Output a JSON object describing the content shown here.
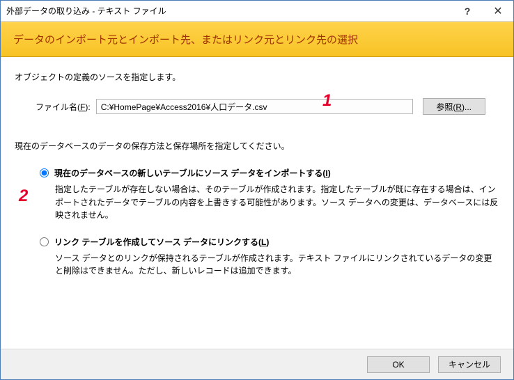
{
  "window": {
    "title": "外部データの取り込み - テキスト ファイル"
  },
  "header": {
    "banner": "データのインポート元とインポート先、またはリンク元とリンク先の選択"
  },
  "body": {
    "source_label": "オブジェクトの定義のソースを指定します。",
    "file_label_pre": "ファイル名(",
    "file_label_key": "F",
    "file_label_post": "):",
    "file_value": "C:¥HomePage¥Access2016¥人口データ.csv",
    "browse_pre": "参照(",
    "browse_key": "R",
    "browse_post": ")...",
    "instruction": "現在のデータベースのデータの保存方法と保存場所を指定してください。",
    "options": [
      {
        "label_pre": "現在のデータベースの新しいテーブルにソース データをインポートする(",
        "label_key": "I",
        "label_post": ")",
        "desc": "指定したテーブルが存在しない場合は、そのテーブルが作成されます。指定したテーブルが既に存在する場合は、インポートされたデータでテーブルの内容を上書きする可能性があります。ソース データへの変更は、データベースには反映されません。",
        "checked": true
      },
      {
        "label_pre": "リンク テーブルを作成してソース データにリンクする(",
        "label_key": "L",
        "label_post": ")",
        "desc": "ソース データとのリンクが保持されるテーブルが作成されます。テキスト ファイルにリンクされているデータの変更と削除はできません。ただし、新しいレコードは追加できます。",
        "checked": false
      }
    ]
  },
  "footer": {
    "ok": "OK",
    "cancel": "キャンセル"
  },
  "annotations": {
    "a1": "1",
    "a2": "2"
  }
}
